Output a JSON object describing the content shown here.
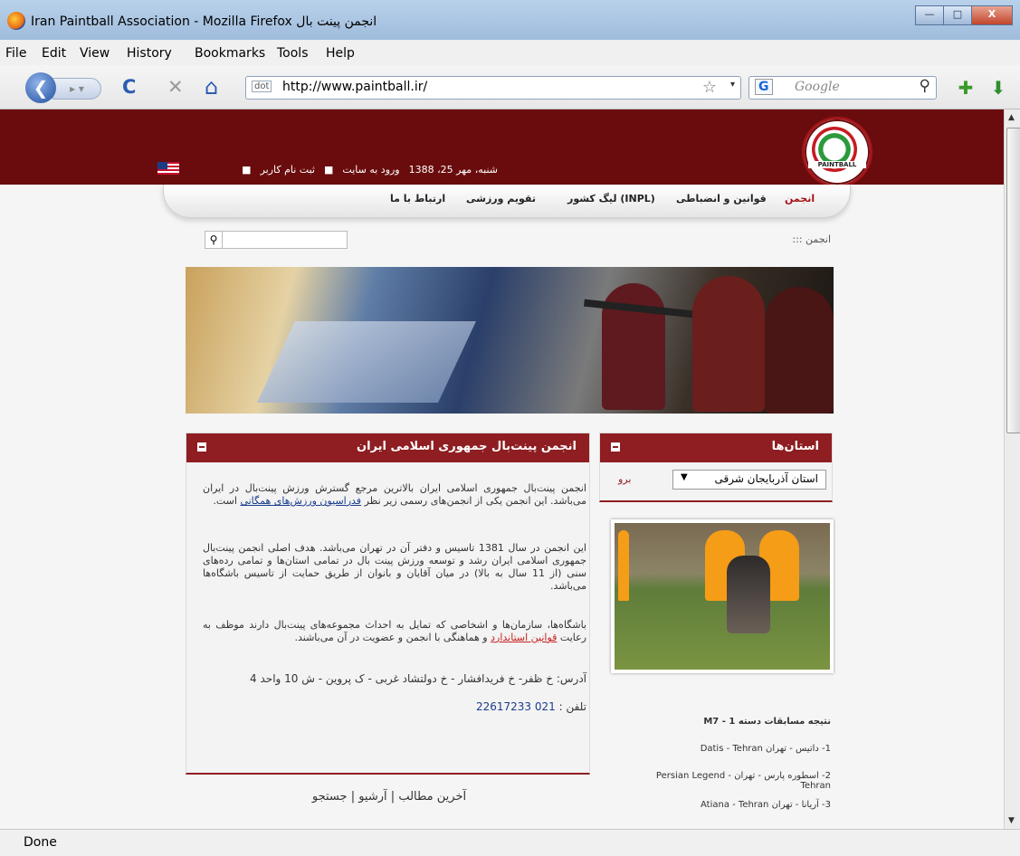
{
  "window": {
    "title": "Iran Paintball Association - Mozilla Firefox انجمن پینت بال",
    "minimize": "—",
    "maximize": "□",
    "close": "X"
  },
  "menu": [
    "File",
    "Edit",
    "View",
    "History",
    "Bookmarks",
    "Tools",
    "Help"
  ],
  "toolbar": {
    "back_glyph": "❮",
    "forward_glyph": "▸ ▾",
    "reload_glyph": "C",
    "stop_glyph": "✕",
    "home_glyph": "⌂",
    "url": "http://www.paintball.ir/",
    "site_badge": "dot",
    "star_glyph": "☆",
    "dropdown_glyph": "▾",
    "search_engine": "G",
    "search_placeholder": "Google",
    "search_glyph": "⚲",
    "addon_glyph": "✚",
    "download_glyph": "⬇"
  },
  "status": "Done",
  "site": {
    "logo_text": "PAINTBALL",
    "date": "شنبه، مهر 25، 1388",
    "login": "ورود به سایت",
    "register": "ثبت نام کاربر",
    "bullet": "■",
    "nav": [
      {
        "label": "انجمن",
        "active": true
      },
      {
        "label": "قوانین و انضباطی",
        "active": false
      },
      {
        "label": "لیگ کشور (INPL)",
        "active": false
      },
      {
        "label": "تقویم ورزشی",
        "active": false
      },
      {
        "label": "ارتباط با ما",
        "active": false
      }
    ],
    "search_glyph": "⚲",
    "breadcrumb": "::: انجمن",
    "main_box": {
      "title": "انجمن پینت‌بال جمهوری اسلامی ایران",
      "p1_text": "انجمن پینت‌بال جمهوری اسلامی ایران بالاترین مرجع گسترش ورزش پینت‌بال در ایران می‌باشد. این انجمن یکی از انجمن‌های رسمی زیر نظر ",
      "p1_link": "فدراسیون ورزش‌های همگانی",
      "p1_end": " است.",
      "p2": "این انجمن در سال 1381 تاسیس و دفتر آن در تهران می‌باشد. هدف اصلی انجمن پینت‌بال جمهوری اسلامی ایران رشد و توسعه ورزش پینت بال در تمامی استان‌ها و تمامی رده‌های سنی (از 11 سال به بالا) در میان آقایان و بانوان از طریق حمایت از تاسیس باشگاه‌ها می‌باشد.",
      "p3_text": "باشگاه‌ها، سازمان‌ها و اشخاصی که تمایل به احداث مجموعه‌های پینت‌بال دارند موظف به رعایت ",
      "p3_link": "قوانین استاندارد",
      "p3_end": " و هماهنگی با انجمن و عضویت در آن می‌باشند.",
      "address": "آدرس: خ ظفر- خ فریدافشار - خ دولتشاد غربی - ک پروین - ش 10 واحد 4",
      "phone_label": "تلفن : ",
      "phone": "021 22617233"
    },
    "province_box": {
      "title": "استان‌ها",
      "selected": "استان آذربایجان شرقی",
      "select_arrow": "▼",
      "go": "برو"
    },
    "results": {
      "title": "نتیجه مسابقات دسته 1 - M7",
      "items": [
        "1- داتیس - تهران Datis - Tehran",
        "2- اسطوره پارس - تهران Persian Legend - Tehran",
        "3- آریانا - تهران Atiana - Tehran"
      ]
    },
    "footer": {
      "latest": "آخرین مطالب",
      "sep": "|",
      "archive": "آرشیو",
      "search": "جستجو"
    }
  }
}
